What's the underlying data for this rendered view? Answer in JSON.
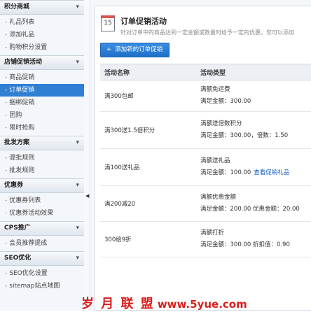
{
  "sidebar": {
    "sections": [
      {
        "title": "积分商城",
        "items": [
          {
            "label": "礼品列表"
          },
          {
            "label": "添加礼品"
          },
          {
            "label": "购物积分设置"
          }
        ]
      },
      {
        "title": "店铺促销活动",
        "items": [
          {
            "label": "商品促销"
          },
          {
            "label": "订单促销",
            "active": true
          },
          {
            "label": "捆绑促销"
          },
          {
            "label": "团购"
          },
          {
            "label": "限时抢购"
          }
        ]
      },
      {
        "title": "批发方案",
        "items": [
          {
            "label": "混批规则"
          },
          {
            "label": "批发规则"
          }
        ]
      },
      {
        "title": "优惠券",
        "items": [
          {
            "label": "优惠券列表"
          },
          {
            "label": "优惠券活动效果"
          }
        ]
      },
      {
        "title": "CPS推广",
        "items": [
          {
            "label": "会员推荐提成"
          }
        ]
      },
      {
        "title": "SEO优化",
        "items": [
          {
            "label": "SEO优化设置"
          },
          {
            "label": "sitemap站点地图"
          }
        ]
      }
    ],
    "chevron_icon": "chevron-down-icon",
    "dash": "-"
  },
  "collapse": {
    "icon": "triangle-left-icon"
  },
  "panel": {
    "icon": "calendar-icon",
    "icon_number": "15",
    "title": "订单促销活动",
    "description": "针对订单中的商品达到一定金额或数量时给予一定的优惠，您可以添加",
    "add_button": "添加新的订单促销",
    "add_icon": "plus-icon"
  },
  "table": {
    "headers": [
      "活动名称",
      "活动类型"
    ],
    "rows": [
      {
        "name": "满300包邮",
        "type_line1": "满额免运费",
        "type_line2": "满足金额：300.00",
        "extra": ""
      },
      {
        "name": "满300送1.5倍积分",
        "type_line1": "满额送倍数积分",
        "type_line2": "满足金额：300.00，倍数：1.50",
        "extra": ""
      },
      {
        "name": "满100送礼品",
        "type_line1": "满额送礼品",
        "type_line2": "满足金额：100.00",
        "extra": "查看促销礼品"
      },
      {
        "name": "满200减20",
        "type_line1": "满额优惠金额",
        "type_line2": "满足金额：200.00 优惠金额：20.00",
        "extra": ""
      },
      {
        "name": "300给9折",
        "type_line1": "满额打折",
        "type_line2": "满足金额：300.00 折扣值：0.90",
        "extra": ""
      }
    ]
  },
  "watermark": {
    "text": "岁 月 联 盟",
    "site": "www.5yue.com"
  },
  "colors": {
    "accent": "#2f7fd4",
    "button": "#1e6fc7",
    "link": "#1a5fc0",
    "watermark": "#d7201d"
  }
}
